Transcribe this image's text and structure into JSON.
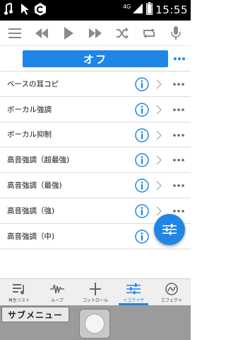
{
  "status": {
    "network": "4G",
    "time": "15:55",
    "notification_icons": [
      "music-note-icon",
      "cursor-icon",
      "app-c-icon"
    ]
  },
  "toolbar": {
    "buttons": [
      "menu-icon",
      "rewind-icon",
      "play-icon",
      "fast-forward-icon",
      "shuffle-icon",
      "repeat-icon",
      "microphone-icon"
    ]
  },
  "preset": {
    "title": "オフ"
  },
  "list": [
    {
      "label": "ベースの耳コピ"
    },
    {
      "label": "ボーカル強調"
    },
    {
      "label": "ボーカル抑制"
    },
    {
      "label": "高音強調（超最強)"
    },
    {
      "label": "高音強調（最強)"
    },
    {
      "label": "高音強調（強)"
    },
    {
      "label": "高音強調（中)"
    }
  ],
  "tabs": [
    {
      "label": "再生リスト",
      "icon": "playlist-icon"
    },
    {
      "label": "ループ",
      "icon": "waveform-icon"
    },
    {
      "label": "コントロール",
      "icon": "crosshair-icon"
    },
    {
      "label": "イコライザ",
      "icon": "equalizer-icon",
      "active": true
    },
    {
      "label": "エフェクト",
      "icon": "effect-icon"
    }
  ],
  "softkeys": {
    "submenu_label": "サブメニュー"
  },
  "colors": {
    "accent": "#1f86e6",
    "statusbar": "#000000",
    "tabbar": "#efefef",
    "softbar": "#9b9b9b"
  }
}
